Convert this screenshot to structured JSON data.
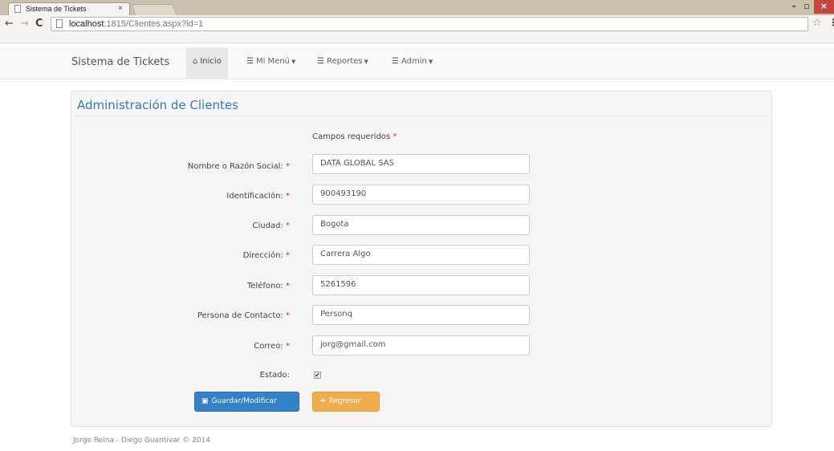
{
  "browser": {
    "tab_title": "Sistema de Tickets",
    "tab_close": "×",
    "url_host": "localhost",
    "url_rest": ":1815/Clientes.aspx?id=1",
    "window_minimize": "–",
    "window_maximize": "▫",
    "window_close": "×"
  },
  "navbar": {
    "brand": "Sistema de Tickets",
    "items": [
      {
        "label": "Inicio",
        "icon": "home-icon",
        "active": true
      },
      {
        "label": "Mi Menú",
        "icon": "list-icon"
      },
      {
        "label": "Reportes",
        "icon": "list-icon"
      },
      {
        "label": "Admin",
        "icon": "list-icon"
      }
    ]
  },
  "panel": {
    "title": "Administración de Clientes",
    "required_note": "Campos requeridos",
    "required_mark": "*"
  },
  "form": {
    "fields": [
      {
        "label": "Nombre o Razón Social:",
        "value": "DATA GLOBAL SAS"
      },
      {
        "label": "Identificación:",
        "value": "900493190"
      },
      {
        "label": "Ciudad:",
        "value": "Bogota"
      },
      {
        "label": "Dirección:",
        "value": "Carrera Algo"
      },
      {
        "label": "Teléfono:",
        "value": "5261596"
      },
      {
        "label": "Persona de Contacto:",
        "value": "Personq"
      },
      {
        "label": "Correo:",
        "value": "jorg@gmail.com"
      }
    ],
    "estado_label": "Estado:",
    "estado_checked": true
  },
  "buttons": {
    "save": "Guardar/Modificar",
    "back": "Regresar"
  },
  "footer": "Jorge Reina - Diego Guantivar © 2014",
  "colors": {
    "primary": "#3281c9",
    "warning": "#f0ad4e",
    "title_blue": "#3a79b9",
    "required_red": "#d9312b"
  }
}
